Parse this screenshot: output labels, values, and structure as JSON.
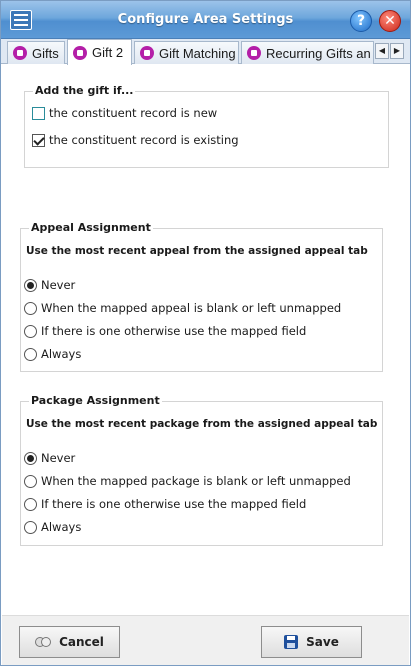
{
  "window": {
    "title": "Configure Area Settings"
  },
  "tabs": [
    {
      "label": "Gifts",
      "active": false
    },
    {
      "label": "Gift 2",
      "active": true
    },
    {
      "label": "Gift Matching",
      "active": false
    },
    {
      "label": "Recurring Gifts an",
      "active": false
    }
  ],
  "tab_scroll": {
    "left": "◀",
    "right": "▶"
  },
  "add_gift": {
    "legend": "Add the gift if...",
    "options": [
      {
        "label": "the constituent record is new",
        "checked": false
      },
      {
        "label": "the constituent record is existing",
        "checked": true
      }
    ]
  },
  "appeal": {
    "legend": "Appeal Assignment",
    "subhead": "Use the most recent appeal from the assigned appeal tab",
    "options": [
      {
        "label": "Never",
        "selected": true
      },
      {
        "label": "When the mapped appeal is blank or left unmapped",
        "selected": false
      },
      {
        "label": "If there is one otherwise use the mapped field",
        "selected": false
      },
      {
        "label": "Always",
        "selected": false
      }
    ]
  },
  "package": {
    "legend": "Package Assignment",
    "subhead": "Use the most recent package from the assigned appeal tab",
    "options": [
      {
        "label": "Never",
        "selected": true
      },
      {
        "label": "When the mapped package is blank or left unmapped",
        "selected": false
      },
      {
        "label": "If there is one otherwise use the mapped field",
        "selected": false
      },
      {
        "label": "Always",
        "selected": false
      }
    ]
  },
  "footer": {
    "cancel_label": "Cancel",
    "save_label": "Save"
  },
  "icons": {
    "app": "list-form-icon",
    "help": "help-icon",
    "close": "close-icon",
    "tab": "gift-icon",
    "cancel": "cancel-icon",
    "save": "save-disk-icon"
  },
  "help_glyph": "?",
  "close_glyph": "✕",
  "colors": {
    "titlebar": "#5d9ad6",
    "tab_icon": "#b41fa8",
    "save_icon": "#1e4f9c"
  }
}
